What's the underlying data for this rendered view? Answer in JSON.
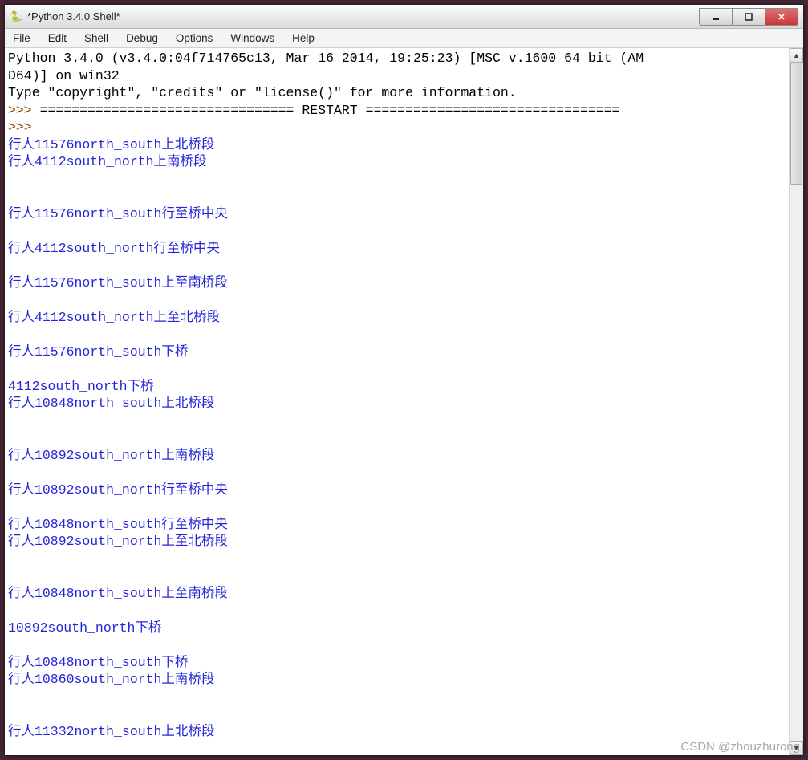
{
  "window": {
    "title": "*Python 3.4.0 Shell*"
  },
  "menubar": {
    "items": [
      "File",
      "Edit",
      "Shell",
      "Debug",
      "Options",
      "Windows",
      "Help"
    ]
  },
  "console": {
    "header1": "Python 3.4.0 (v3.4.0:04f714765c13, Mar 16 2014, 19:25:23) [MSC v.1600 64 bit (AM",
    "header2": "D64)] on win32",
    "header3": "Type \"copyright\", \"credits\" or \"license()\" for more information.",
    "prompt1": ">>> ",
    "restart_line": "================================ RESTART ================================",
    "prompt2": ">>> ",
    "output_lines": [
      "行人11576north_south上北桥段",
      "行人4112south_north上南桥段",
      "",
      "",
      "行人11576north_south行至桥中央",
      "",
      "行人4112south_north行至桥中央",
      "",
      "行人11576north_south上至南桥段",
      "",
      "行人4112south_north上至北桥段",
      "",
      "行人11576north_south下桥",
      "",
      "4112south_north下桥",
      "行人10848north_south上北桥段",
      "",
      "",
      "行人10892south_north上南桥段",
      "",
      "行人10892south_north行至桥中央",
      "",
      "行人10848north_south行至桥中央",
      "行人10892south_north上至北桥段",
      "",
      "",
      "行人10848north_south上至南桥段",
      "",
      "10892south_north下桥",
      "",
      "行人10848north_south下桥",
      "行人10860south_north上南桥段",
      "",
      "",
      "行人11332north_south上北桥段"
    ]
  },
  "watermark": "CSDN @zhouzhurong"
}
